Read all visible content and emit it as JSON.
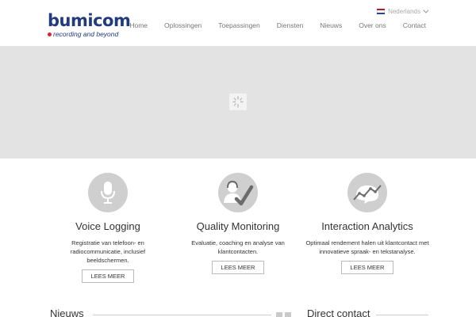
{
  "header": {
    "logo_word": "bumicom",
    "logo_tagline": "recording and beyond",
    "language": "Nederlands",
    "nav": [
      "Home",
      "Oplossingen",
      "Toepassingen",
      "Diensten",
      "Nieuws",
      "Over ons",
      "Contact"
    ]
  },
  "features": [
    {
      "title": "Voice Logging",
      "description": "Registratie van telefoon- en radiocommunicatie, inclusief beeldschermen.",
      "button": "LEES MEER",
      "icon": "microphone-icon"
    },
    {
      "title": "Quality Monitoring",
      "description": "Evaluatie, coaching en analyse van klantcontacten.",
      "button": "LEES MEER",
      "icon": "agent-check-icon"
    },
    {
      "title": "Interaction Analytics",
      "description": "Optimaal rendement halen uit klantcontact met innovatieve spraak- en tekstanalyse.",
      "button": "LEES MEER",
      "icon": "analytics-chart-icon"
    }
  ],
  "bottom": {
    "news_title": "Nieuws",
    "contact_title": "Direct contact"
  },
  "colors": {
    "brand": "#203c7d",
    "brand_dot": "#d8262f",
    "hero_bg": "#e3e3e3",
    "icon_circle": "#cfcfcf"
  }
}
